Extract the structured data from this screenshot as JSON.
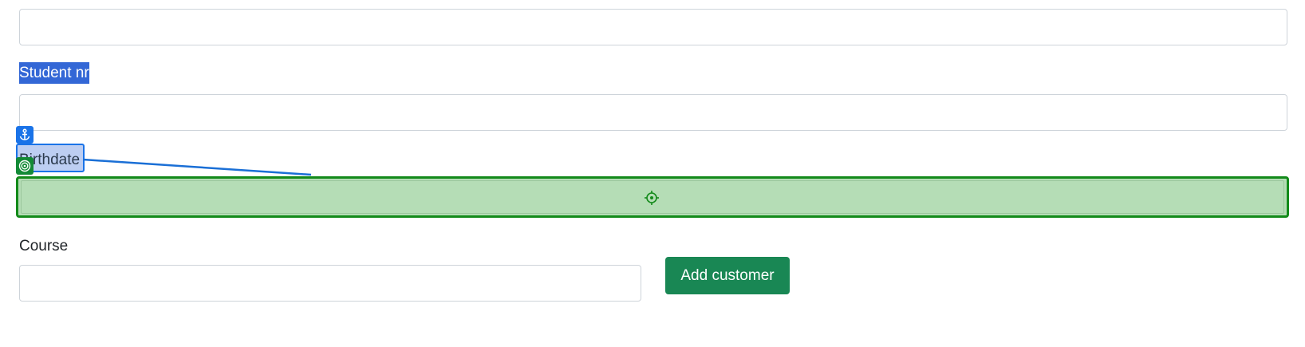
{
  "form": {
    "top_field": {
      "value": "",
      "placeholder": ""
    },
    "student_nr": {
      "label": "Student nr",
      "value": "",
      "placeholder": ""
    },
    "birthdate": {
      "label": "Birthdate",
      "value": "",
      "placeholder": ""
    },
    "course": {
      "label": "Course",
      "value": "",
      "placeholder": ""
    },
    "submit_label": "Add customer"
  },
  "overlay": {
    "anchor_icon": "anchor-icon",
    "target_icon": "target-icon",
    "crosshair_icon": "crosshair-icon",
    "colors": {
      "selection": "#3367d6",
      "anchor": "#1a73e8",
      "drop_target_border": "#138a1a",
      "drop_target_fill": "#b5ddb6",
      "button": "#198754"
    }
  }
}
